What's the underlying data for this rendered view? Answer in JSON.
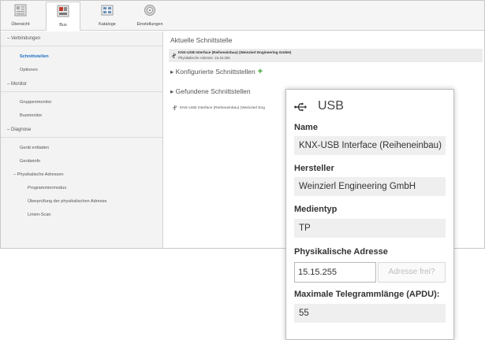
{
  "ribbon": {
    "tabs": [
      {
        "label": "Übersicht",
        "icon": "overview-icon"
      },
      {
        "label": "Bus",
        "icon": "bus-icon",
        "active": true
      },
      {
        "label": "Kataloge",
        "icon": "catalog-icon"
      },
      {
        "label": "Einstellungen",
        "icon": "settings-gear-icon"
      }
    ]
  },
  "sidebar": {
    "verbindungen": "Verbindungen",
    "schnittstellen": "Schnittstellen",
    "optionen": "Optionen",
    "monitor": "Monitor",
    "gruppenmonitor": "Gruppenmonitor",
    "busmonitor": "Busmonitor",
    "diagnose": "Diagnose",
    "geraet_entladen": "Gerät entladen",
    "geraeteinfo": "Geräteinfo",
    "physikalische_adressen": "Physikalische Adressen",
    "programmiermodus": "Programmiermodus",
    "ueberpruefung": "Überprüfung der physikalischen Adresse",
    "linien_scan": "Linien-Scan"
  },
  "main": {
    "aktuelle_title": "Aktuelle Schnittstelle",
    "current_name": "KNX-USB Interface (Reiheneinbau) (Weinzierl Engineering GmbH)",
    "current_addr": "Physikalische Adresse: 15.15.255",
    "konfigurierte_title": "Konfigurierte Schnittstellen",
    "gefundene_title": "Gefundene Schnittstellen",
    "found_item": "KNX-USB Interface (Reiheneinbau) (Weinzierl Eng"
  },
  "panel": {
    "title": "USB",
    "name_label": "Name",
    "name_value": "KNX-USB Interface (Reiheneinbau)",
    "hersteller_label": "Hersteller",
    "hersteller_value": "Weinzierl Engineering GmbH",
    "medientyp_label": "Medientyp",
    "medientyp_value": "TP",
    "phys_label": "Physikalische Adresse",
    "phys_value": "15.15.255",
    "adresse_frei_button": "Adresse frei?",
    "apdu_label": "Maximale Telegrammlänge (APDU):",
    "apdu_value": "55"
  },
  "colors": {
    "accent_blue": "#1a6fc0",
    "plus_green": "#3aa335"
  }
}
